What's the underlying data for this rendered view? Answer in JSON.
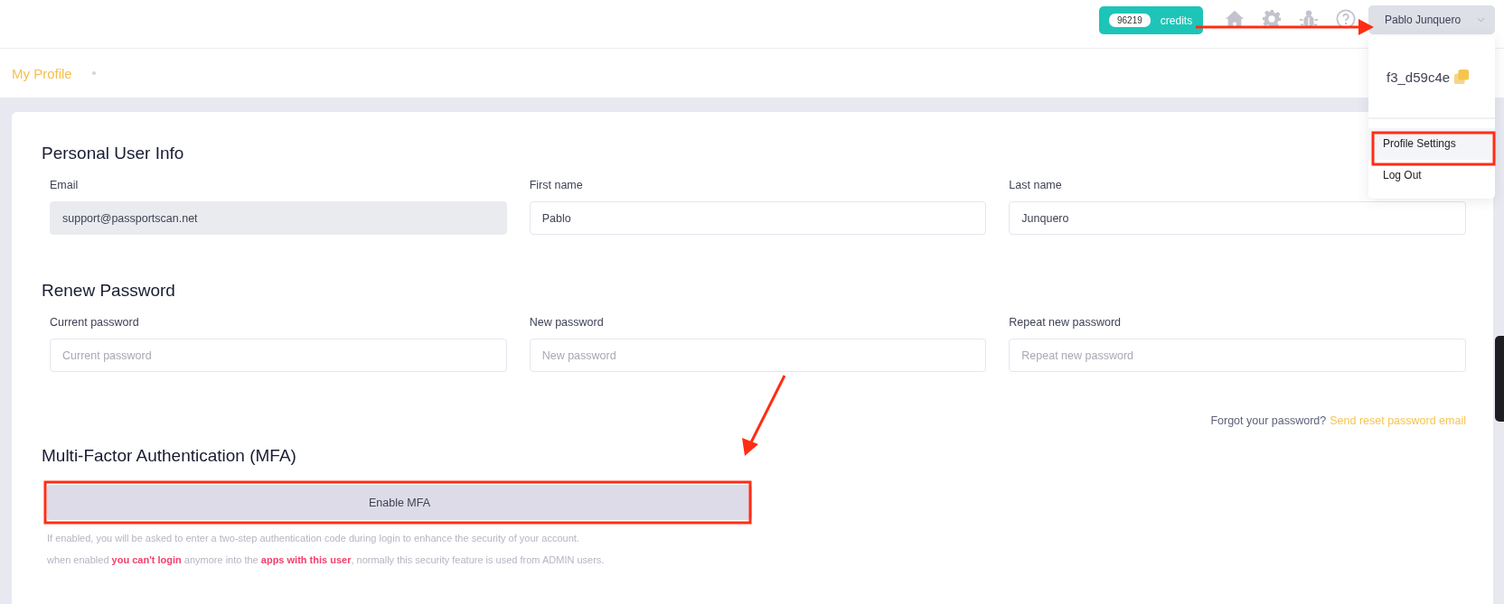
{
  "header": {
    "credits_count": "96219",
    "credits_label": "credits",
    "user_menu": {
      "name": "Pablo Junquero",
      "expanded": true
    }
  },
  "breadcrumb": {
    "title": "My Profile"
  },
  "user_dropdown": {
    "user_id": "f3_d59c4e",
    "items": [
      {
        "label": "Profile Settings",
        "selected": true
      },
      {
        "label": "Log Out",
        "selected": false
      }
    ]
  },
  "personal_info": {
    "title": "Personal User Info",
    "fields": [
      {
        "label": "Email",
        "value": "support@passportscan.net",
        "disabled": true
      },
      {
        "label": "First name",
        "value": "Pablo",
        "disabled": false
      },
      {
        "label": "Last name",
        "value": "Junquero",
        "disabled": false
      }
    ]
  },
  "renew_password": {
    "title": "Renew Password",
    "fields": [
      {
        "label": "Current password",
        "placeholder": "Current password"
      },
      {
        "label": "New password",
        "placeholder": "New password"
      },
      {
        "label": "Repeat new password",
        "placeholder": "Repeat new password"
      }
    ],
    "forgot_text": "Forgot your password?",
    "reset_link": "Send reset password email"
  },
  "mfa": {
    "title": "Multi-Factor Authentication (MFA)",
    "button": "Enable MFA",
    "notes": [
      "If enabled, you will be asked to enter a two-step authentication code during login to enhance the security of your account.",
      "when enabled **you can't login** anymore into the **apps with this user**, normally this security feature is used from ADMIN users."
    ]
  }
}
